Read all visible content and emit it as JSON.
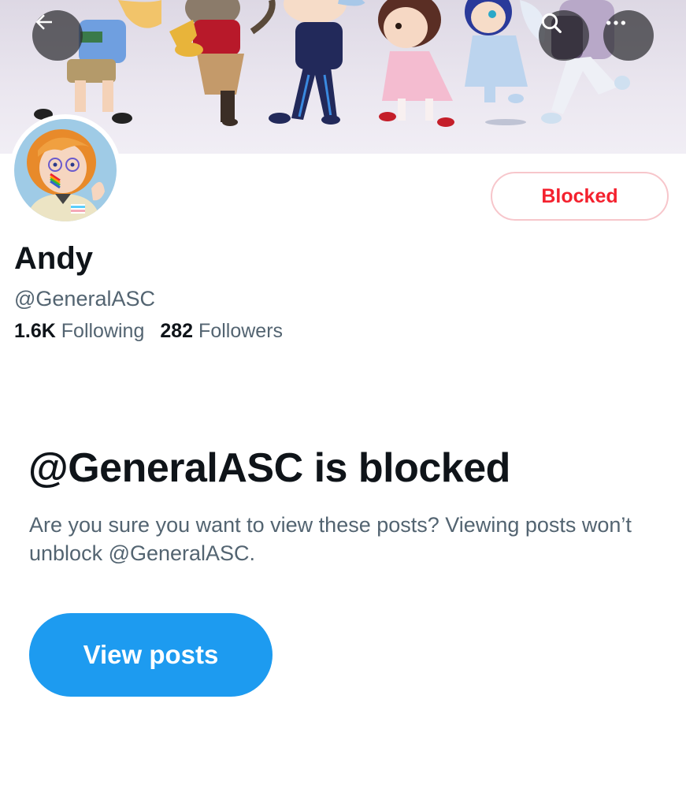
{
  "header": {
    "back_icon": "arrow-left-icon",
    "search_icon": "search-icon",
    "more_icon": "more-horizontal-icon"
  },
  "profile": {
    "display_name": "Andy",
    "handle": "@GeneralASC",
    "following_count": "1.6K",
    "following_label": "Following",
    "followers_count": "282",
    "followers_label": "Followers",
    "blocked_button_label": "Blocked"
  },
  "blocked_notice": {
    "title": "@GeneralASC is blocked",
    "description": "Are you sure you want to view these posts? Viewing posts won’t unblock @GeneralASC.",
    "view_posts_label": "View posts"
  },
  "colors": {
    "accent_blue": "#1d9bf0",
    "blocked_red": "#f4212e",
    "secondary_text": "#536471",
    "primary_text": "#0f1419"
  }
}
